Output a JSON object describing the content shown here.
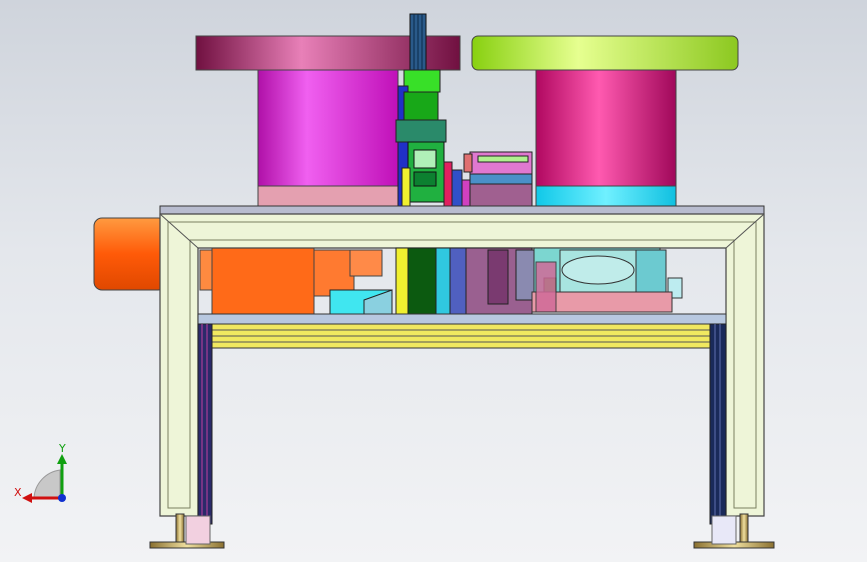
{
  "viewport": {
    "background_top": "#cfd4dc",
    "background_bottom": "#f2f3f5"
  },
  "model": {
    "colors": {
      "left_reel_flange": "#b04880",
      "left_reel_body": "#d81fd0",
      "left_reel_collar": "#e09aa8",
      "right_reel_flange": "#a6e63a",
      "right_reel_body": "#d21078",
      "right_reel_collar": "#2fd8f0",
      "frame": "#eef5d8",
      "frame_edge": "#555555",
      "motor": "#ff6a1a",
      "motor_housing": "#ff7a20",
      "tabletop": "#b9bdd0",
      "rails": "#e8e060",
      "bearing_block": "#7cd6d0",
      "legs_feet": "#b8a060"
    }
  },
  "triad": {
    "x_label": "X",
    "y_label": "Y",
    "x_color": "#d01010",
    "y_color": "#10a010",
    "z_color": "#1030d0"
  }
}
